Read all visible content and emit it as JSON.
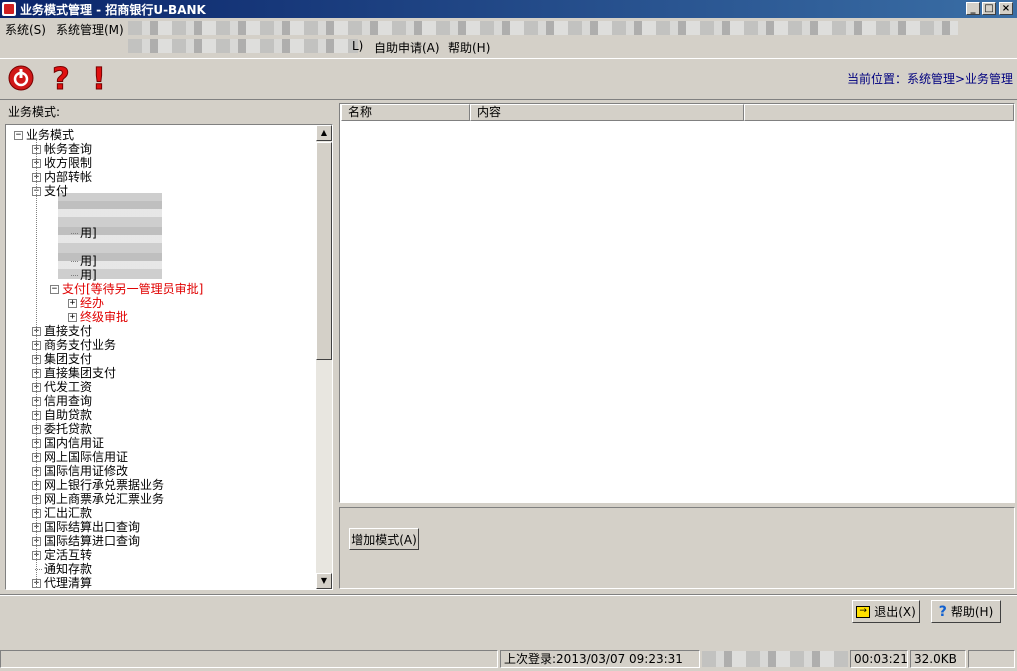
{
  "window": {
    "title": "业务模式管理 - 招商银行U-BANK",
    "min": "_",
    "max": "□",
    "close": "×"
  },
  "menu": [
    {
      "label": "系统(S)"
    },
    {
      "label": "系统管理(M)"
    },
    {
      "label": "L)"
    },
    {
      "label": "自助申请(A)"
    },
    {
      "label": "帮助(H)"
    }
  ],
  "toolbar": {
    "location": "当前位置：系统管理>业务管理"
  },
  "left": {
    "label": "业务模式:"
  },
  "tree": [
    {
      "text": "业务模式",
      "pm": "⊟",
      "level": 0
    },
    {
      "text": "帐务查询",
      "pm": "+",
      "level": 1
    },
    {
      "text": "收方限制",
      "pm": "+",
      "level": 1
    },
    {
      "text": "内部转帐",
      "pm": "+",
      "level": 1
    },
    {
      "text": "支付",
      "pm": "−",
      "level": 1
    },
    {
      "text": "用]",
      "pm": "",
      "level": 3
    },
    {
      "text": "用]",
      "pm": "",
      "level": 3
    },
    {
      "text": "用]",
      "pm": "",
      "level": 3
    },
    {
      "text": "支付[等待另一管理员审批]",
      "pm": "−",
      "level": 2,
      "red": true
    },
    {
      "text": "经办",
      "pm": "+",
      "level": 3,
      "red": true
    },
    {
      "text": "终级审批",
      "pm": "+",
      "level": 3,
      "red": true
    },
    {
      "text": "直接支付",
      "pm": "+",
      "level": 1
    },
    {
      "text": "商务支付业务",
      "pm": "+",
      "level": 1
    },
    {
      "text": "集团支付",
      "pm": "+",
      "level": 1
    },
    {
      "text": "直接集团支付",
      "pm": "+",
      "level": 1
    },
    {
      "text": "代发工资",
      "pm": "+",
      "level": 1
    },
    {
      "text": "信用查询",
      "pm": "+",
      "level": 1
    },
    {
      "text": "自助贷款",
      "pm": "+",
      "level": 1
    },
    {
      "text": "委托贷款",
      "pm": "+",
      "level": 1
    },
    {
      "text": "国内信用证",
      "pm": "+",
      "level": 1
    },
    {
      "text": "网上国际信用证",
      "pm": "+",
      "level": 1
    },
    {
      "text": "国际信用证修改",
      "pm": "+",
      "level": 1
    },
    {
      "text": "网上银行承兑票据业务",
      "pm": "+",
      "level": 1
    },
    {
      "text": "网上商票承兑汇票业务",
      "pm": "+",
      "level": 1
    },
    {
      "text": "汇出汇款",
      "pm": "+",
      "level": 1
    },
    {
      "text": "国际结算出口查询",
      "pm": "+",
      "level": 1
    },
    {
      "text": "国际结算进口查询",
      "pm": "+",
      "level": 1
    },
    {
      "text": "定活互转",
      "pm": "+",
      "level": 1
    },
    {
      "text": "通知存款",
      "pm": "",
      "level": 1
    },
    {
      "text": "代理清算",
      "pm": "+",
      "level": 1
    }
  ],
  "list": {
    "col_name": "名称",
    "col_content": "内容"
  },
  "buttons": {
    "add_mode": "增加模式(A)",
    "exit": "退出(X)",
    "help": "帮助(H)"
  },
  "status": {
    "last_login": "上次登录:2013/03/07 09:23:31",
    "elapsed": "00:03:21",
    "size": "32.0KB"
  },
  "colors": {
    "title_start": "#0a246a",
    "title_end": "#3a6ea5",
    "tree_red": "#e00000",
    "location_blue": "#00007f"
  }
}
